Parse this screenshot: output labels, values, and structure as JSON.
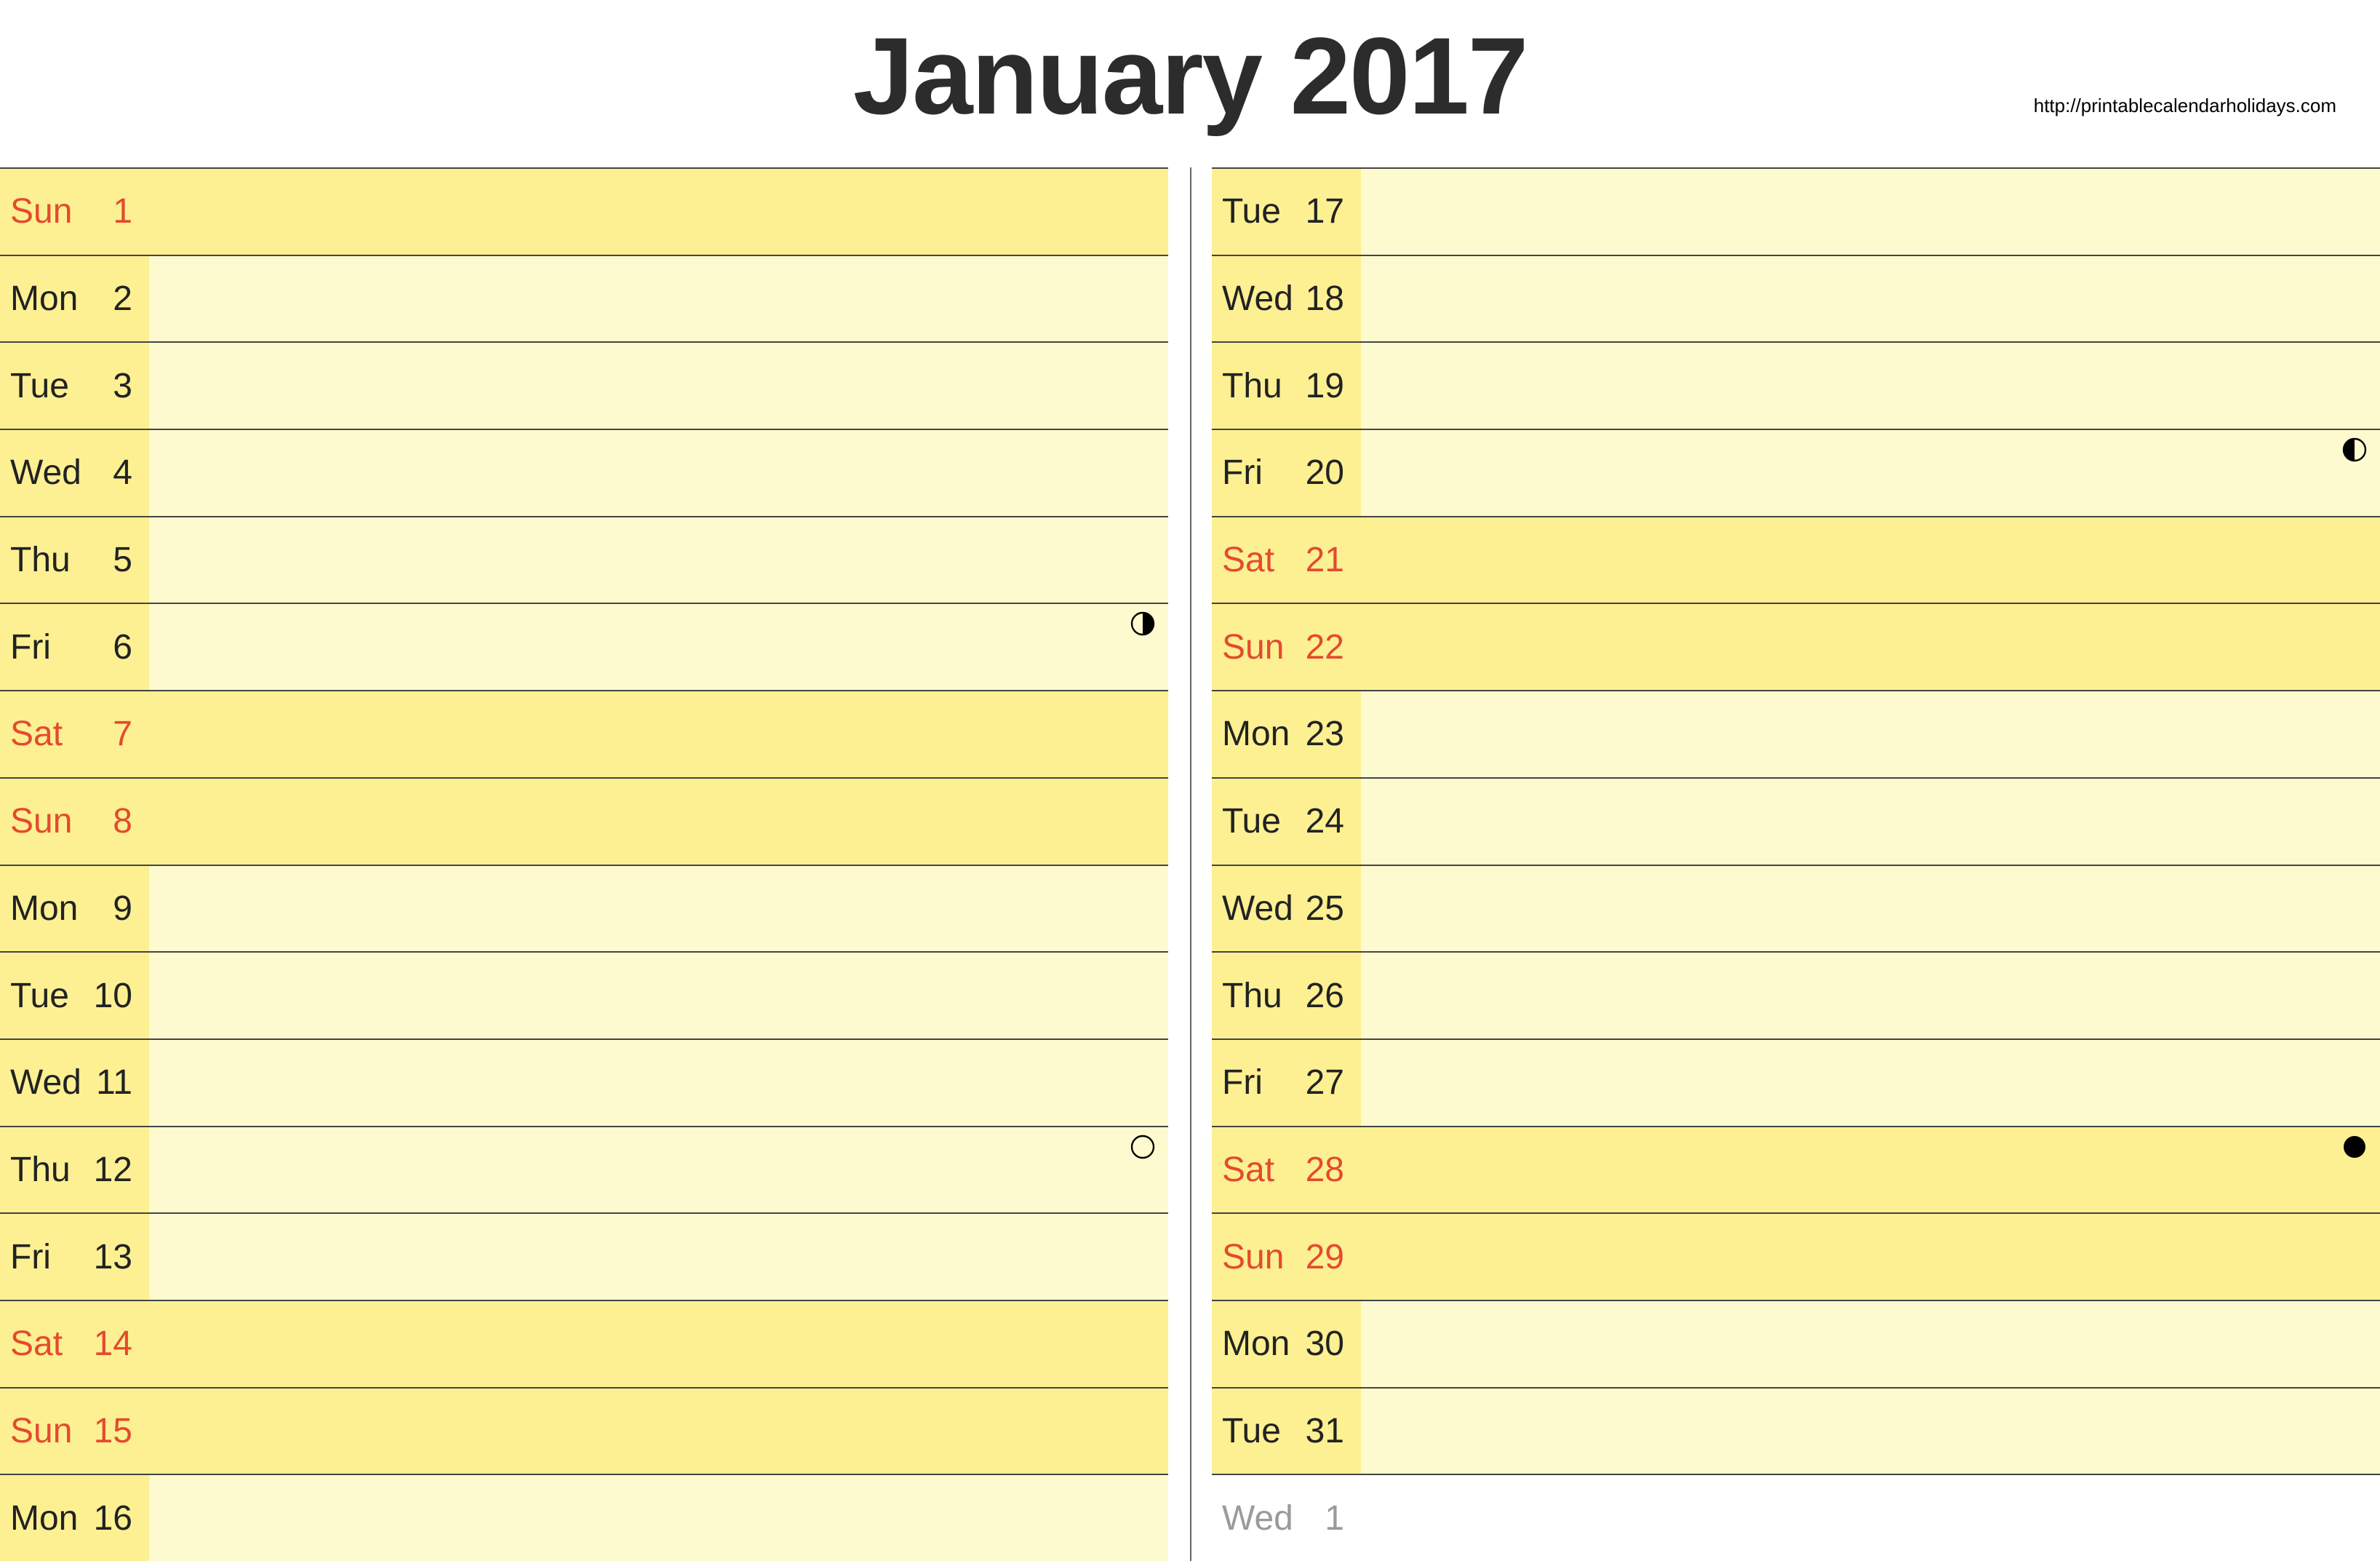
{
  "header": {
    "title": "January 2017",
    "source_url": "http://printablecalendarholidays.com"
  },
  "columns": {
    "left": [
      {
        "dow": "Sun",
        "num": "1",
        "weekend": true,
        "moon": null,
        "nextmonth": false
      },
      {
        "dow": "Mon",
        "num": "2",
        "weekend": false,
        "moon": null,
        "nextmonth": false
      },
      {
        "dow": "Tue",
        "num": "3",
        "weekend": false,
        "moon": null,
        "nextmonth": false
      },
      {
        "dow": "Wed",
        "num": "4",
        "weekend": false,
        "moon": null,
        "nextmonth": false
      },
      {
        "dow": "Thu",
        "num": "5",
        "weekend": false,
        "moon": null,
        "nextmonth": false
      },
      {
        "dow": "Fri",
        "num": "6",
        "weekend": false,
        "moon": "first-quarter",
        "nextmonth": false
      },
      {
        "dow": "Sat",
        "num": "7",
        "weekend": true,
        "moon": null,
        "nextmonth": false
      },
      {
        "dow": "Sun",
        "num": "8",
        "weekend": true,
        "moon": null,
        "nextmonth": false
      },
      {
        "dow": "Mon",
        "num": "9",
        "weekend": false,
        "moon": null,
        "nextmonth": false
      },
      {
        "dow": "Tue",
        "num": "10",
        "weekend": false,
        "moon": null,
        "nextmonth": false
      },
      {
        "dow": "Wed",
        "num": "11",
        "weekend": false,
        "moon": null,
        "nextmonth": false
      },
      {
        "dow": "Thu",
        "num": "12",
        "weekend": false,
        "moon": "full",
        "nextmonth": false
      },
      {
        "dow": "Fri",
        "num": "13",
        "weekend": false,
        "moon": null,
        "nextmonth": false
      },
      {
        "dow": "Sat",
        "num": "14",
        "weekend": true,
        "moon": null,
        "nextmonth": false
      },
      {
        "dow": "Sun",
        "num": "15",
        "weekend": true,
        "moon": null,
        "nextmonth": false
      },
      {
        "dow": "Mon",
        "num": "16",
        "weekend": false,
        "moon": null,
        "nextmonth": false
      }
    ],
    "right": [
      {
        "dow": "Tue",
        "num": "17",
        "weekend": false,
        "moon": null,
        "nextmonth": false
      },
      {
        "dow": "Wed",
        "num": "18",
        "weekend": false,
        "moon": null,
        "nextmonth": false
      },
      {
        "dow": "Thu",
        "num": "19",
        "weekend": false,
        "moon": null,
        "nextmonth": false
      },
      {
        "dow": "Fri",
        "num": "20",
        "weekend": false,
        "moon": "last-quarter",
        "nextmonth": false
      },
      {
        "dow": "Sat",
        "num": "21",
        "weekend": true,
        "moon": null,
        "nextmonth": false
      },
      {
        "dow": "Sun",
        "num": "22",
        "weekend": true,
        "moon": null,
        "nextmonth": false
      },
      {
        "dow": "Mon",
        "num": "23",
        "weekend": false,
        "moon": null,
        "nextmonth": false
      },
      {
        "dow": "Tue",
        "num": "24",
        "weekend": false,
        "moon": null,
        "nextmonth": false
      },
      {
        "dow": "Wed",
        "num": "25",
        "weekend": false,
        "moon": null,
        "nextmonth": false
      },
      {
        "dow": "Thu",
        "num": "26",
        "weekend": false,
        "moon": null,
        "nextmonth": false
      },
      {
        "dow": "Fri",
        "num": "27",
        "weekend": false,
        "moon": null,
        "nextmonth": false
      },
      {
        "dow": "Sat",
        "num": "28",
        "weekend": true,
        "moon": "new",
        "nextmonth": false
      },
      {
        "dow": "Sun",
        "num": "29",
        "weekend": true,
        "moon": null,
        "nextmonth": false
      },
      {
        "dow": "Mon",
        "num": "30",
        "weekend": false,
        "moon": null,
        "nextmonth": false
      },
      {
        "dow": "Tue",
        "num": "31",
        "weekend": false,
        "moon": null,
        "nextmonth": false
      },
      {
        "dow": "Wed",
        "num": "1",
        "weekend": false,
        "moon": null,
        "nextmonth": true
      }
    ]
  }
}
